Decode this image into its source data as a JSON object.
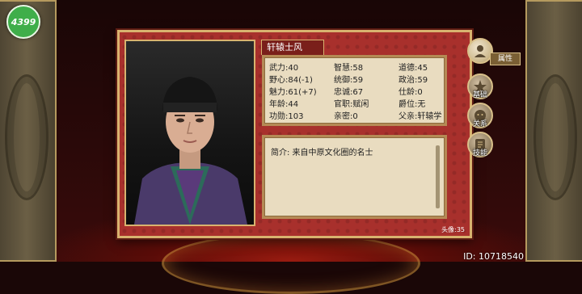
{
  "logo": "4399",
  "character": {
    "name": "轩辕士风",
    "portrait_no": "头像:35",
    "intro": "简介: 来自中原文化圈的名士",
    "stats": [
      [
        "武力:40",
        "智慧:58",
        "道德:45"
      ],
      [
        "野心:84(-1)",
        "统御:59",
        "政治:59"
      ],
      [
        "魅力:61(+7)",
        "忠诚:67",
        "仕龄:0"
      ],
      [
        "年龄:44",
        "官职:赋闲",
        "爵位:无"
      ],
      [
        "功勋:103",
        "亲密:0",
        "父亲:轩辕学"
      ]
    ]
  },
  "side_buttons": {
    "attributes": "属性",
    "b2": "基础",
    "b3": "关系",
    "b4": "技能"
  },
  "footer": {
    "id": "ID: 10718540"
  },
  "colors": {
    "panel": "#a8302c",
    "frame_gold": "#d8b36f",
    "parchment": "#e9dcc0"
  }
}
